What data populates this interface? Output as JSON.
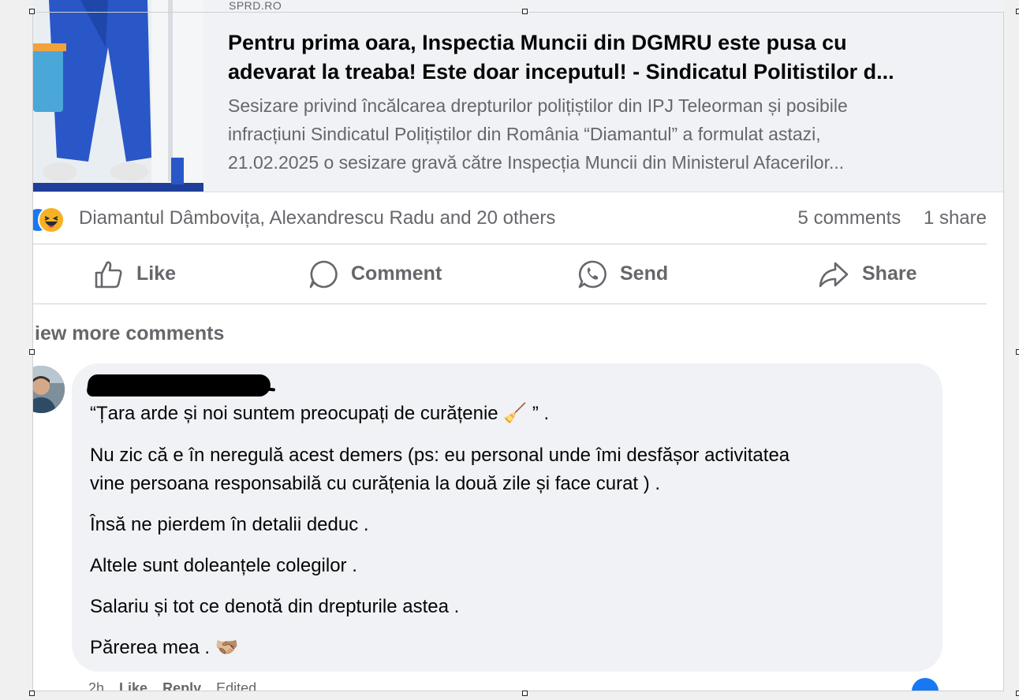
{
  "link_preview": {
    "domain": "SPRD.RO",
    "title_line1": "Pentru prima oara, Inspectia Muncii din DGMRU este pusa cu",
    "title_line2": "adevarat la treaba! Este doar inceputul! - Sindicatul Politistilor d...",
    "desc_line1": "Sesizare privind încălcarea drepturilor polițiștilor din IPJ Teleorman și posibile",
    "desc_line2": "infracțiuni Sindicatul Polițiștilor din România “Diamantul” a formulat astazi,",
    "desc_line3": "21.02.2025 o sesizare gravă către Inspecția Muncii din Ministerul Afacerilor..."
  },
  "reactions": {
    "icons": [
      "like-reaction-icon",
      "haha-reaction-icon"
    ],
    "reactors": "Diamantul Dâmbovița, Alexandrescu Radu and 20 others",
    "comments_count": "5 comments",
    "shares_count": "1 share"
  },
  "actions": {
    "like": "Like",
    "comment": "Comment",
    "send": "Send",
    "share": "Share"
  },
  "comments": {
    "view_more": "iew more comments",
    "author_visible": "A",
    "lines": [
      "“Țara arde și noi suntem preocupați de curățenie 🧹 ” .",
      "Nu zic că e în neregulă acest demers (ps: eu personal unde îmi desfășor activitatea",
      "vine persoana responsabilă cu curățenia la două zile și face curat ) .",
      "Însă ne pierdem în detalii deduc .",
      "Altele sunt doleanțele colegilor .",
      "Salariu și tot ce denotă din drepturile astea .",
      "Părerea mea . 🫱🏼‍🫲🏽"
    ],
    "meta": {
      "time": "2h",
      "like": "Like",
      "reply": "Reply",
      "edited": "Edited"
    }
  },
  "colors": {
    "accent": "#1877f2",
    "muted_text": "#65676b",
    "bubble": "#f0f2f5"
  }
}
